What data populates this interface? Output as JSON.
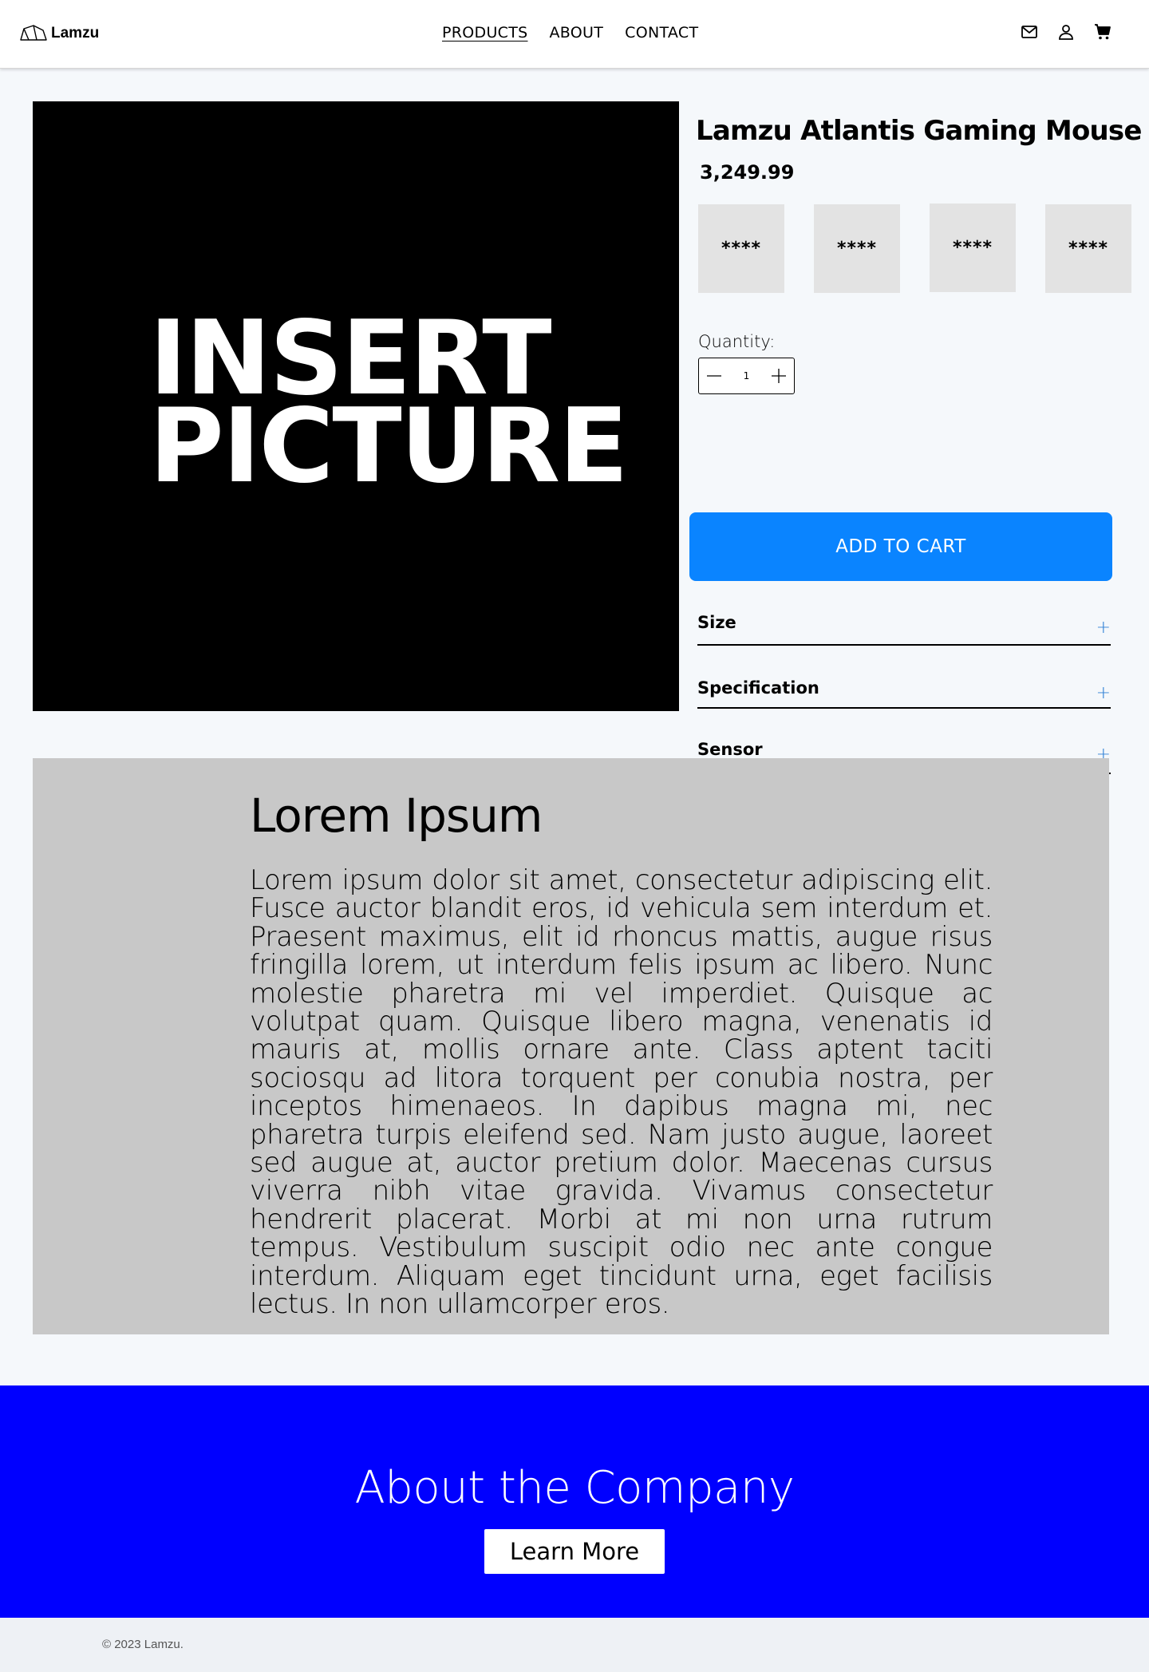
{
  "header": {
    "logo_text": "Lamzu",
    "nav": [
      {
        "label": "PRODUCTS",
        "active": true
      },
      {
        "label": "ABOUT",
        "active": false
      },
      {
        "label": "CONTACT",
        "active": false
      }
    ],
    "icons": [
      "mail-icon",
      "user-icon",
      "cart-icon"
    ]
  },
  "hero": {
    "line1": "INSERT",
    "line2": "PICTURE"
  },
  "product": {
    "title": "Lamzu Atlantis Gaming Mouse",
    "price": "3,249.99",
    "swatches": [
      "****",
      "****",
      "****",
      "****"
    ],
    "quantity_label": "Quantity:",
    "quantity_value": "1",
    "add_to_cart": "ADD TO CART",
    "accordion": [
      {
        "label": "Size",
        "icon": "+"
      },
      {
        "label": "Specification",
        "icon": "+"
      },
      {
        "label": "Sensor",
        "icon": "+"
      }
    ]
  },
  "lorem": {
    "heading": "Lorem Ipsum",
    "body": "Lorem ipsum dolor sit amet, consectetur adipiscing elit. Fusce auctor blandit eros, id vehicula sem interdum et. Praesent maximus, elit id rhoncus mattis, augue risus fringilla lorem, ut interdum felis ipsum ac libero. Nunc molestie pharetra mi vel imperdiet. Quisque ac volutpat quam. Quisque libero magna, venenatis id mauris at, mollis ornare ante. Class aptent taciti sociosqu ad litora torquent per conubia nostra, per inceptos himenaeos. In dapibus magna mi, nec pharetra turpis eleifend sed. Nam justo augue, laoreet sed augue at, auctor pretium dolor. Maecenas cursus viverra nibh vitae gravida. Vivamus consectetur hendrerit placerat. Morbi at mi non urna rutrum tempus. Vestibulum suscipit odio nec ante congue interdum. Aliquam eget tincidunt urna, eget facilisis lectus. In non ullamcorper eros."
  },
  "about": {
    "heading": "About the Company",
    "button": "Learn More"
  },
  "footer": {
    "copyright": "© 2023 Lamzu."
  },
  "colors": {
    "accent_blue": "#0a84ff",
    "about_bg": "#0000ff",
    "hero_bg": "#000000",
    "lorem_bg": "#c8c8c8"
  }
}
